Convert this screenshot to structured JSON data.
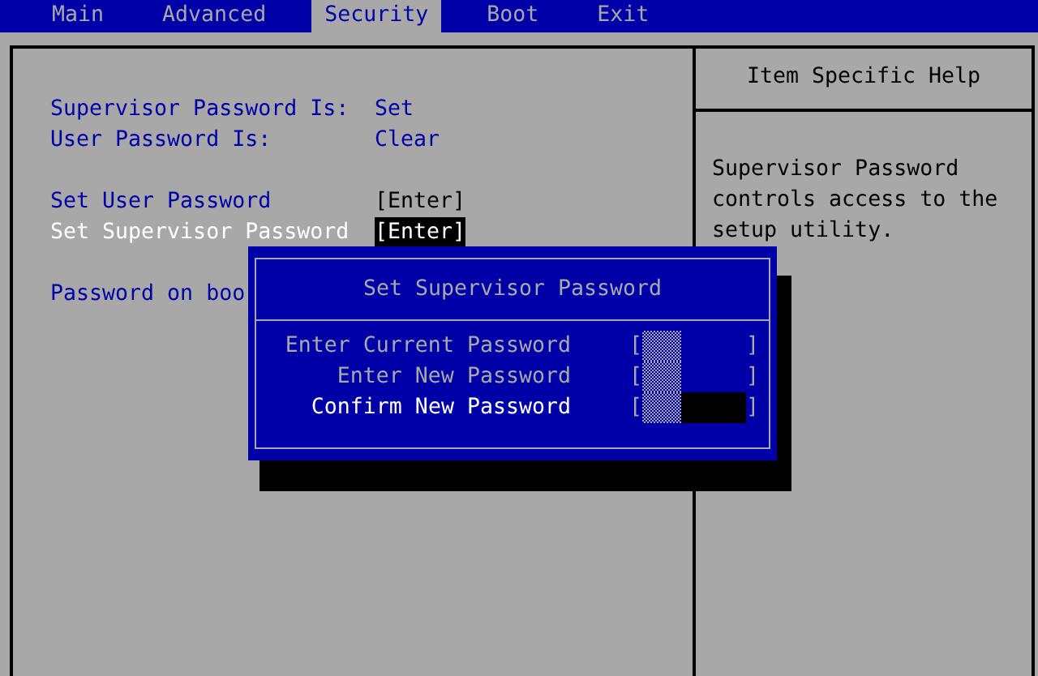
{
  "menu": [
    {
      "label": "Main",
      "selected": false
    },
    {
      "label": "Advanced",
      "selected": false
    },
    {
      "label": "Security",
      "selected": true
    },
    {
      "label": "Boot",
      "selected": false
    },
    {
      "label": "Exit",
      "selected": false
    }
  ],
  "status": [
    {
      "label": "Supervisor Password Is:",
      "value": "Set"
    },
    {
      "label": "User Password Is:",
      "value": "Clear"
    }
  ],
  "items": [
    {
      "label": "Set User Password",
      "value": "[Enter]",
      "selected": false
    },
    {
      "label": "Set Supervisor Password",
      "value": "[Enter]",
      "selected": true
    }
  ],
  "more_items": [
    {
      "label": "Password on boo"
    }
  ],
  "help": {
    "title": "Item Specific Help",
    "text": "Supervisor Password controls access to the setup utility."
  },
  "dialog": {
    "title": "Set Supervisor Password",
    "fields": [
      {
        "label": "Enter Current Password",
        "open": "[",
        "close": "]",
        "selected": false
      },
      {
        "label": "Enter New Password",
        "open": "[",
        "close": "]",
        "selected": false
      },
      {
        "label": "Confirm New Password",
        "open": "[",
        "close": "]",
        "selected": true
      }
    ]
  }
}
